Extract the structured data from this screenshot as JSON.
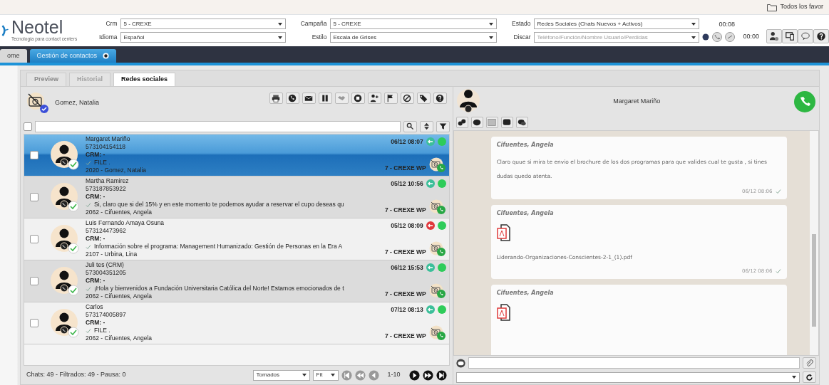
{
  "browser_bar": {
    "bookmarks": "Todos los favor"
  },
  "logo": {
    "name": "Neotel",
    "tagline": "Tecnología para contact centers"
  },
  "filters": [
    {
      "label": "Crm",
      "value": "5 - CREXE"
    },
    {
      "label": "Idioma",
      "value": "Español"
    },
    {
      "label": "Campaña",
      "value": "5 - CREXE"
    },
    {
      "label": "Estilo",
      "value": "Escala de Grises"
    }
  ],
  "estado": {
    "label": "Estado",
    "value": "Redes Sociales (Chats Nuevos + Activos)"
  },
  "discar": {
    "label": "Discar",
    "placeholder": "Teléfono/Función/Nombre Usuario/Perdidas"
  },
  "timers": [
    "00:08",
    "00:00"
  ],
  "app_tabs": [
    {
      "label": "ome",
      "selected": false
    },
    {
      "label": "Gestión de contactos",
      "selected": true
    }
  ],
  "view_tabs": [
    {
      "label": "Preview",
      "selected": false,
      "disabled": false
    },
    {
      "label": "Historial",
      "selected": false,
      "disabled": true
    },
    {
      "label": "Redes sociales",
      "selected": true,
      "disabled": false
    }
  ],
  "agent": {
    "name": "Gomez, Natalia"
  },
  "select_all": {
    "checked": false
  },
  "chats": [
    {
      "name": "Margaret Mariño",
      "phone": "573104154118",
      "crm": "CRM: -",
      "message": "FILE .",
      "agent": "2020 - Gomez, Natalia",
      "time": "06/12 08:07",
      "campaign": "7 - CREXE WP",
      "color": "#3cbf9a",
      "selected": true,
      "checked": false
    },
    {
      "name": "Martha Ramirez",
      "phone": "573187853922",
      "crm": "CRM: -",
      "message": "Si, claro que si del 15% y en este momento te podemos ayudar a reservar el cupo deseas qu",
      "agent": "2062 - Cifuentes, Angela",
      "time": "05/12 10:56",
      "campaign": "7 - CREXE WP",
      "color": "#3cbf9a",
      "selected": false,
      "checked": false
    },
    {
      "name": "Luis Fernando Amaya Osuna",
      "phone": "573124473962",
      "crm": "CRM: -",
      "message": "Información sobre el programa: Management Humanizado: Gestión de Personas en la Era A",
      "agent": "2107 - Urbina, Lina",
      "time": "05/12 08:09",
      "campaign": "7 - CREXE WP",
      "color": "#e0393e",
      "selected": false,
      "checked": false
    },
    {
      "name": "Juli tes (CRM)",
      "phone": "573004351205",
      "crm": "CRM: -",
      "message": "¡Hola y bienvenidos a Fundación Universitaria Católica del Norte! Estamos emocionados de t",
      "agent": "2062 - Cifuentes, Angela",
      "time": "06/12 15:53",
      "campaign": "7 - CREXE WP",
      "color": "#3cbf9a",
      "selected": false,
      "checked": false
    },
    {
      "name": "Carlos",
      "phone": "573174005897",
      "crm": "CRM: -",
      "message": "FILE .",
      "agent": "2062 - Cifuentes, Angela",
      "time": "07/12 08:13",
      "campaign": "7 - CREXE WP",
      "color": "#3cbf9a",
      "selected": false,
      "checked": false
    }
  ],
  "footer": {
    "summary": "Chats: 49 - Filtrados: 49 - Pausa: 0",
    "filter": "Tomados",
    "zoom": "Fit",
    "page": "1-10"
  },
  "conversation": {
    "contact": "Margaret Mariño",
    "messages": [
      {
        "kind": "text",
        "author": "Cifuentes, Angela",
        "text": "Claro quue si mira te envio el brochure de los dos programas para que valides cual te gusta , si tines dudas quedo atenta.",
        "time": "06/12 08:06"
      },
      {
        "kind": "file",
        "author": "Cifuentes, Angela",
        "file": "Liderando-Organizaciones-Conscientes-2-1_(1).pdf",
        "time": "06/12 08:06"
      },
      {
        "kind": "file",
        "author": "Cifuentes, Angela"
      }
    ]
  }
}
